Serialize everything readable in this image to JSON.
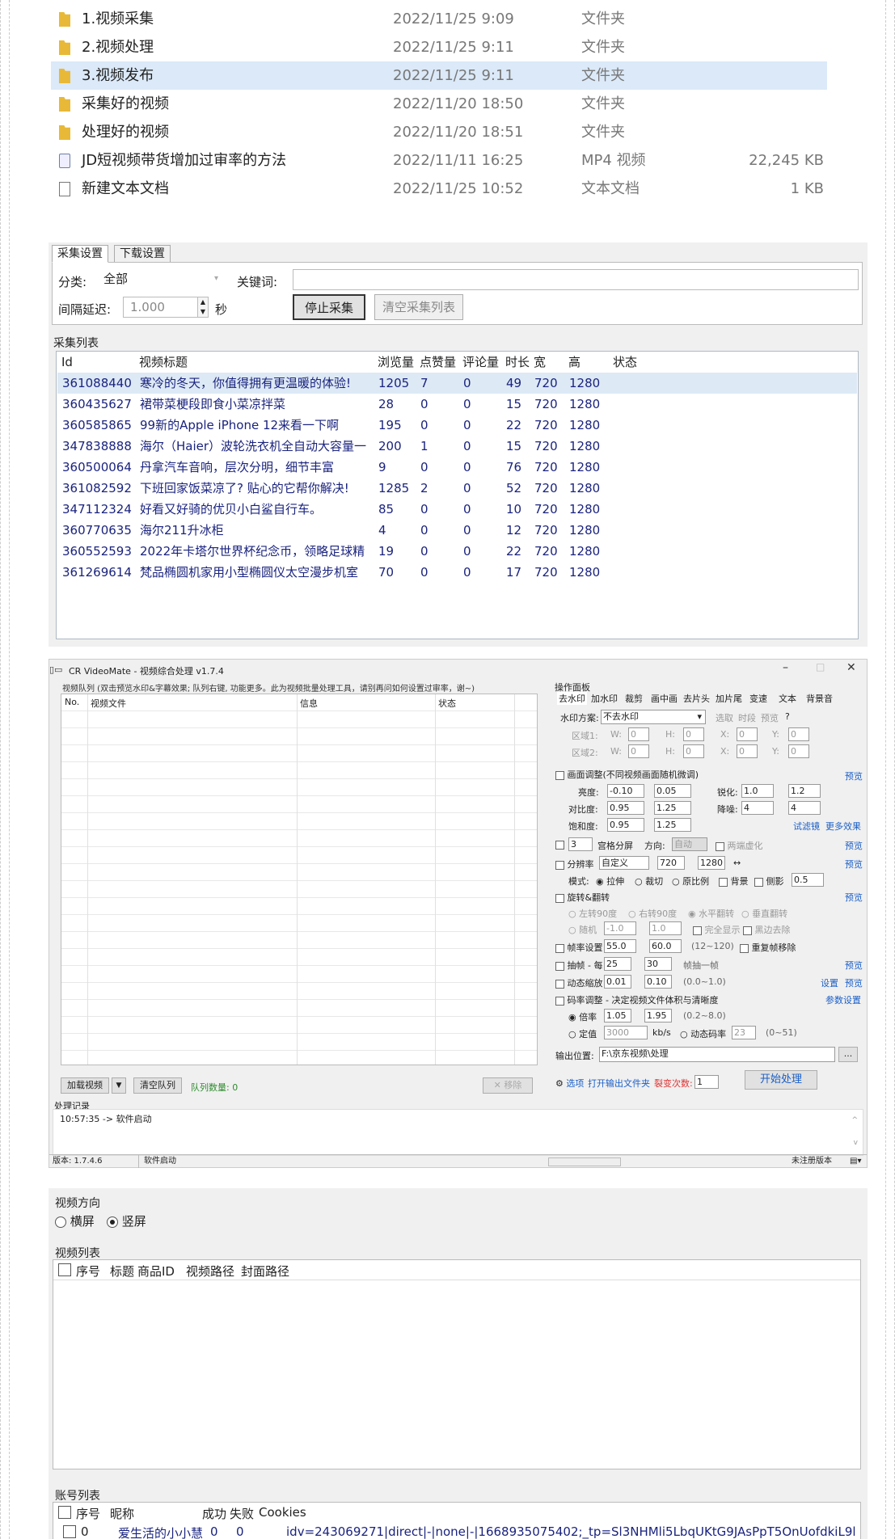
{
  "files": [
    {
      "name": "1.视频采集",
      "date": "2022/11/25 9:09",
      "type": "文件夹",
      "size": "",
      "icon": "folder-icon"
    },
    {
      "name": "2.视频处理",
      "date": "2022/11/25 9:11",
      "type": "文件夹",
      "size": "",
      "icon": "folder-icon"
    },
    {
      "name": "3.视频发布",
      "date": "2022/11/25 9:11",
      "type": "文件夹",
      "size": "",
      "icon": "folder-icon"
    },
    {
      "name": "采集好的视频",
      "date": "2022/11/20 18:50",
      "type": "文件夹",
      "size": "",
      "icon": "folder-icon"
    },
    {
      "name": "处理好的视频",
      "date": "2022/11/20 18:51",
      "type": "文件夹",
      "size": "",
      "icon": "folder-icon"
    },
    {
      "name": "JD短视频带货增加过审率的方法",
      "date": "2022/11/11 16:25",
      "type": "MP4 视频",
      "size": "22,245 KB",
      "icon": "video-file-icon"
    },
    {
      "name": "新建文本文档",
      "date": "2022/11/25 10:52",
      "type": "文本文档",
      "size": "1 KB",
      "icon": "text-file-icon"
    }
  ],
  "collector": {
    "tabs": [
      "采集设置",
      "下载设置"
    ],
    "category_label": "分类:",
    "category_value": "全部",
    "keyword_label": "关键词:",
    "keyword_value": "",
    "delay_label": "间隔延迟:",
    "delay_value": "1.000",
    "delay_unit": "秒",
    "stop_button": "停止采集",
    "clear_button": "清空采集列表",
    "list_title": "采集列表",
    "columns": [
      "Id",
      "视频标题",
      "浏览量",
      "点赞量",
      "评论量",
      "时长",
      "宽",
      "高",
      "状态"
    ],
    "rows": [
      [
        "361088440",
        "寒冷的冬天，你值得拥有更温暖的体验!",
        "1205",
        "7",
        "0",
        "49",
        "720",
        "1280"
      ],
      [
        "360435627",
        "裙带菜梗段即食小菜凉拌菜",
        "28",
        "0",
        "0",
        "15",
        "720",
        "1280"
      ],
      [
        "360585865",
        "99新的Apple iPhone 12来看一下啊",
        "195",
        "0",
        "0",
        "22",
        "720",
        "1280"
      ],
      [
        "347838888",
        "海尔（Haier）波轮洗衣机全自动大容量一",
        "200",
        "1",
        "0",
        "15",
        "720",
        "1280"
      ],
      [
        "360500064",
        "丹拿汽车音响，层次分明，细节丰富",
        "9",
        "0",
        "0",
        "76",
        "720",
        "1280"
      ],
      [
        "361082592",
        "下班回家饭菜凉了? 贴心的它帮你解决!",
        "1285",
        "2",
        "0",
        "52",
        "720",
        "1280"
      ],
      [
        "347112324",
        "好看又好骑的优贝小白鲨自行车。",
        "85",
        "0",
        "0",
        "10",
        "720",
        "1280"
      ],
      [
        "360770635",
        "海尔211升冰柜",
        "4",
        "0",
        "0",
        "12",
        "720",
        "1280"
      ],
      [
        "360552593",
        "2022年卡塔尔世界杯纪念币，领略足球精",
        "19",
        "0",
        "0",
        "22",
        "720",
        "1280"
      ],
      [
        "361269614",
        "梵品椭圆机家用小型椭圆仪太空漫步机室",
        "70",
        "0",
        "0",
        "17",
        "720",
        "1280"
      ]
    ]
  },
  "videomate": {
    "title": "CR VideoMate - 视频综合处理 v1.7.4",
    "queue_title": "视频队列 (双击预览水印&字幕效果; 队列右键, 功能更多。此为视频批量处理工具，请别再问如何设置过审率，谢~)",
    "queue_columns": [
      "No.",
      "视频文件",
      "信息",
      "状态"
    ],
    "add_button": "加载视频",
    "clear_button": "清空队列",
    "queue_count": "队列数量: 0",
    "remove_button": "移除",
    "log_title": "处理记录",
    "log_line": "10:57:35 -> 软件启动",
    "status_version": "版本: 1.7.4.6",
    "status_msg": "软件启动",
    "status_reg": "未注册版本",
    "ops_title": "操作面板",
    "ops_tabs": [
      "去水印",
      "加水印",
      "裁剪",
      "画中画",
      "去片头",
      "加片尾",
      "变速",
      "文本",
      "背景音"
    ],
    "watermark_label": "水印方案:",
    "watermark_value": "不去水印",
    "select_link": "选取",
    "period_link": "时段",
    "preview_link": "预览",
    "region1": "区域1:",
    "region2": "区域2:",
    "w": "W:",
    "h": "H:",
    "x": "X:",
    "y": "Y:",
    "zero": "0",
    "adjust_label": "画面调整(不同视频画面随机微调)",
    "brightness": "亮度:",
    "b1": "-0.10",
    "b2": "0.05",
    "contrast": "对比度:",
    "c1": "0.95",
    "c2": "1.25",
    "saturation": "饱和度:",
    "s1": "0.95",
    "s2": "1.25",
    "sharpen": "锐化:",
    "sh1": "1.0",
    "sh2": "1.2",
    "denoise": "降噪:",
    "dn1": "4",
    "dn2": "4",
    "filter_link": "试滤镜",
    "more_link": "更多效果",
    "grid_value": "3",
    "grid_label": "宫格分屏",
    "direction_label": "方向:",
    "direction_value": "自动",
    "blur_label": "两端虚化",
    "resolution_label": "分辨率",
    "resolution_value": "自定义",
    "res_w": "720",
    "res_h": "1280",
    "mode_label": "模式:",
    "mode_stretch": "拉伸",
    "mode_crop": "裁切",
    "mode_ratio": "原比例",
    "bg_label": "背景",
    "side_label": "侧影",
    "side_value": "0.5",
    "rotate_label": "旋转&翻转",
    "rot_l": "左转90度",
    "rot_r": "右转90度",
    "flip_h": "水平翻转",
    "flip_v": "垂直翻转",
    "random_label": "随机",
    "r1": "-1.0",
    "r2": "1.0",
    "full_label": "完全显示",
    "black_label": "黑边去除",
    "fps_label": "帧率设置",
    "fps1": "55.0",
    "fps2": "60.0",
    "fps_range": "(12~120)",
    "dedup_label": "重复帧移除",
    "extract_label": "抽帧 - 每",
    "ex1": "25",
    "ex2": "30",
    "ex_unit": "帧抽一帧",
    "scale_label": "动态缩放",
    "sc1": "0.01",
    "sc2": "0.10",
    "sc_range": "(0.0~1.0)",
    "settings_link": "设置",
    "bitrate_label": "码率调整 - 决定视频文件体积与清晰度",
    "param_link": "参数设置",
    "mult_label": "倍率",
    "m1": "1.05",
    "m2": "1.95",
    "m_range": "(0.2~8.0)",
    "fixed_label": "定值",
    "fixed_value": "3000",
    "kbs": "kb/s",
    "dyn_label": "动态码率",
    "dyn_value": "23",
    "dyn_range": "(0~51)",
    "output_label": "输出位置:",
    "output_value": "F:\\京东视频\\处理",
    "options_link": "选项",
    "open_folder_link": "打开输出文件夹",
    "split_label": "裂变次数:",
    "split_value": "1",
    "start_button": "开始处理",
    "q": "?"
  },
  "publisher": {
    "direction_title": "视频方向",
    "landscape": "横屏",
    "portrait": "竖屏",
    "video_list_title": "视频列表",
    "video_columns": [
      "序号",
      "标题",
      "商品ID",
      "视频路径",
      "封面路径"
    ],
    "account_list_title": "账号列表",
    "account_columns": [
      "序号",
      "昵称",
      "成功",
      "失败",
      "Cookies"
    ],
    "account_rows": [
      [
        "0",
        "爱生活的小小慧",
        "0",
        "0",
        "idv=243069271|direct|-|none|-|1668935075402;_tp=Sl3NHMli5LbqUKtG9JAsPpT5OnUofdkiL9l"
      ]
    ]
  }
}
